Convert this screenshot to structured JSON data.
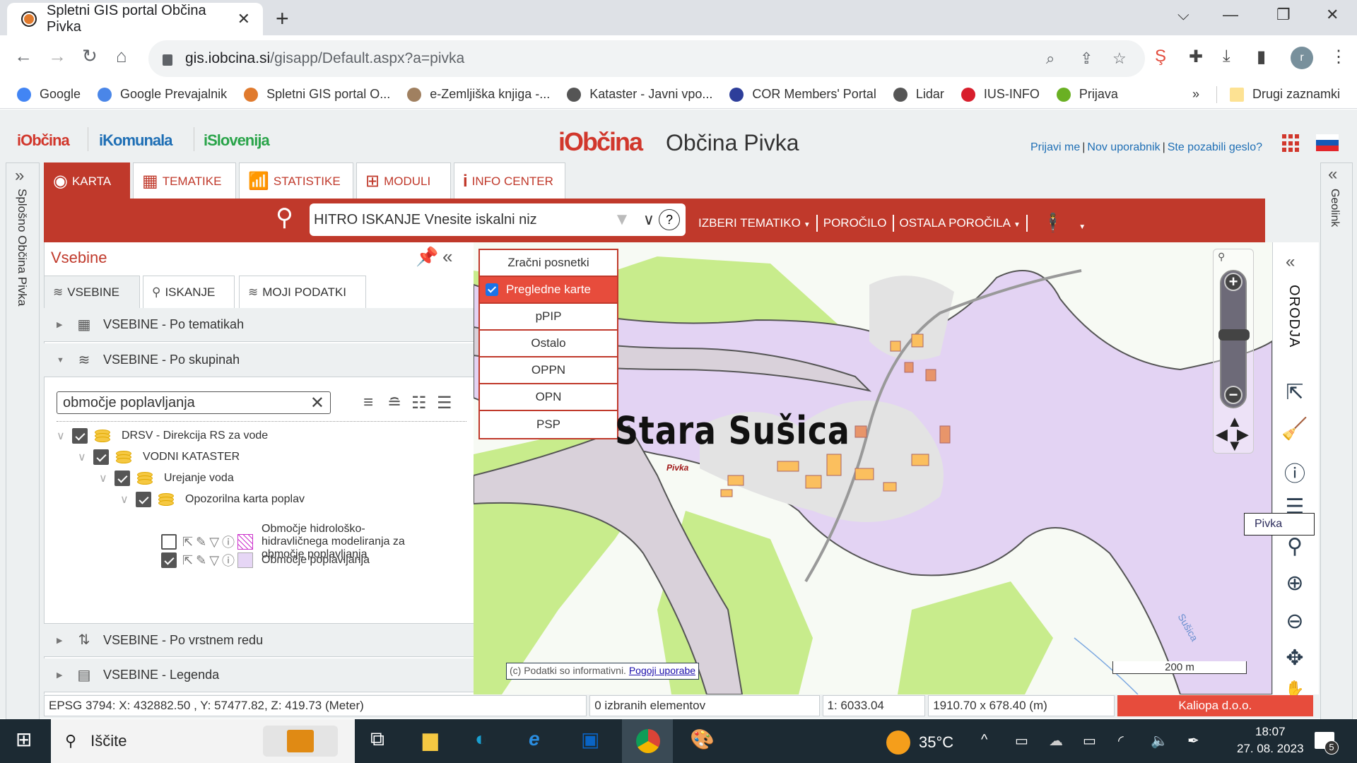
{
  "browser": {
    "tab_title": "Spletni GIS portal Občina Pivka",
    "url_host": "gis.iobcina.si",
    "url_path": "/gisapp/Default.aspx?a=pivka",
    "profile_initial": "r",
    "bookmarks": [
      {
        "label": "Google",
        "icon": "google-icon",
        "color": "#4285f4"
      },
      {
        "label": "Google Prevajalnik",
        "icon": "translate-icon",
        "color": "#4a86e8"
      },
      {
        "label": "Spletni GIS portal O...",
        "icon": "gis-portal-icon",
        "color": "#e07a2d"
      },
      {
        "label": "e-Zemljiška knjiga -...",
        "icon": "scales-icon",
        "color": "#a08060"
      },
      {
        "label": "Kataster - Javni vpo...",
        "icon": "globe-icon",
        "color": "#555555"
      },
      {
        "label": "COR Members' Portal",
        "icon": "eu-flag-icon",
        "color": "#2d3e9a"
      },
      {
        "label": "Lidar",
        "icon": "globe-icon",
        "color": "#555555"
      },
      {
        "label": "IUS-INFO",
        "icon": "ius-info-icon",
        "color": "#d81e2c"
      },
      {
        "label": "Prijava",
        "icon": "prijava-icon",
        "color": "#6ab023"
      }
    ],
    "bookmarks_overflow": "»",
    "other_bookmarks": "Drugi zaznamki"
  },
  "header": {
    "brands": [
      "iObčina",
      "iKomunala",
      "iSlovenija"
    ],
    "logo": "iObčina",
    "municipality": "Občina Pivka",
    "auth_links": [
      "Prijavi me",
      "Nov uporabnik",
      "Ste pozabili geslo?"
    ],
    "left_rail_label": "Splošno Občina Pivka",
    "right_rail_label": "Geolink"
  },
  "main_tabs": [
    {
      "label": "KARTA",
      "icon": "globe-icon",
      "active": true
    },
    {
      "label": "TEMATIKE",
      "icon": "thematic-icon",
      "active": false
    },
    {
      "label": "STATISTIKE",
      "icon": "chart-icon",
      "active": false
    },
    {
      "label": "MODULI",
      "icon": "hierarchy-icon",
      "active": false
    },
    {
      "label": "INFO CENTER",
      "icon": "info-icon",
      "active": false
    }
  ],
  "search": {
    "placeholder": "HITRO ISKANJE Vnesite iskalni niz",
    "help": "?"
  },
  "red_menu": {
    "items": [
      "IZBERI TEMATIKO",
      "POROČILO",
      "OSTALA POROČILA"
    ]
  },
  "panel": {
    "title": "Vsebine",
    "tabs": [
      "VSEBINE",
      "ISKANJE",
      "MOJI PODATKI"
    ],
    "sections": [
      "VSEBINE - Po tematikah",
      "VSEBINE - Po skupinah",
      "VSEBINE - Po vrstnem redu",
      "VSEBINE - Legenda"
    ],
    "filter_value": "območje poplavljanja",
    "tree": [
      {
        "label": "DRSV - Direkcija RS za vode",
        "checked": true,
        "level": 0
      },
      {
        "label": "VODNI KATASTER",
        "checked": true,
        "level": 1
      },
      {
        "label": "Urejanje voda",
        "checked": true,
        "level": 2
      },
      {
        "label": "Opozorilna karta poplav",
        "checked": true,
        "level": 3
      }
    ],
    "layers": [
      {
        "label": "Območje hidrološko-hidravličnega modeliranja za območje poplavljanja",
        "checked": false,
        "swatch": "#cc33cc"
      },
      {
        "label": "Območje poplavljanja",
        "checked": true,
        "swatch": "#e6d6f5"
      }
    ]
  },
  "map": {
    "basemaps": [
      {
        "label": "Zračni posnetki",
        "selected": false
      },
      {
        "label": "Pregledne karte",
        "selected": true
      },
      {
        "label": "pPIP",
        "selected": false
      },
      {
        "label": "Ostalo",
        "selected": false
      },
      {
        "label": "OPPN",
        "selected": false
      },
      {
        "label": "OPN",
        "selected": false
      },
      {
        "label": "PSP",
        "selected": false
      }
    ],
    "place_label": "Stara Sušica",
    "small_label": "Pivka",
    "river_label": "Sušica",
    "copyright_text": "(c) Podatki so informativni.",
    "copyright_link": "Pogoji uporabe",
    "scale_bar": "200 m",
    "tooltip": "Pivka",
    "tools_label": "ORODJA",
    "colors": {
      "flood": "#e3d3f3",
      "forest": "#c8ec8c",
      "settlement": "#dcdcdc",
      "building": "#fbbf5e",
      "border": "#555555"
    }
  },
  "status": {
    "coords": "EPSG 3794: X: 432882.50 , Y: 57477.82, Z: 419.73 (Meter)",
    "selected": "0 izbranih elementov",
    "scale": "1: 6033.04",
    "extent": "1910.70 x 678.40 (m)",
    "vendor": "Kaliopa d.o.o."
  },
  "taskbar": {
    "search": "Iščite",
    "weather": "35°C",
    "time": "18:07",
    "date": "27. 08. 2023",
    "notifications": "5"
  },
  "colors": {
    "accent": "#c0392b",
    "accent_light": "#e74c3c",
    "link": "#1f6fb5"
  }
}
